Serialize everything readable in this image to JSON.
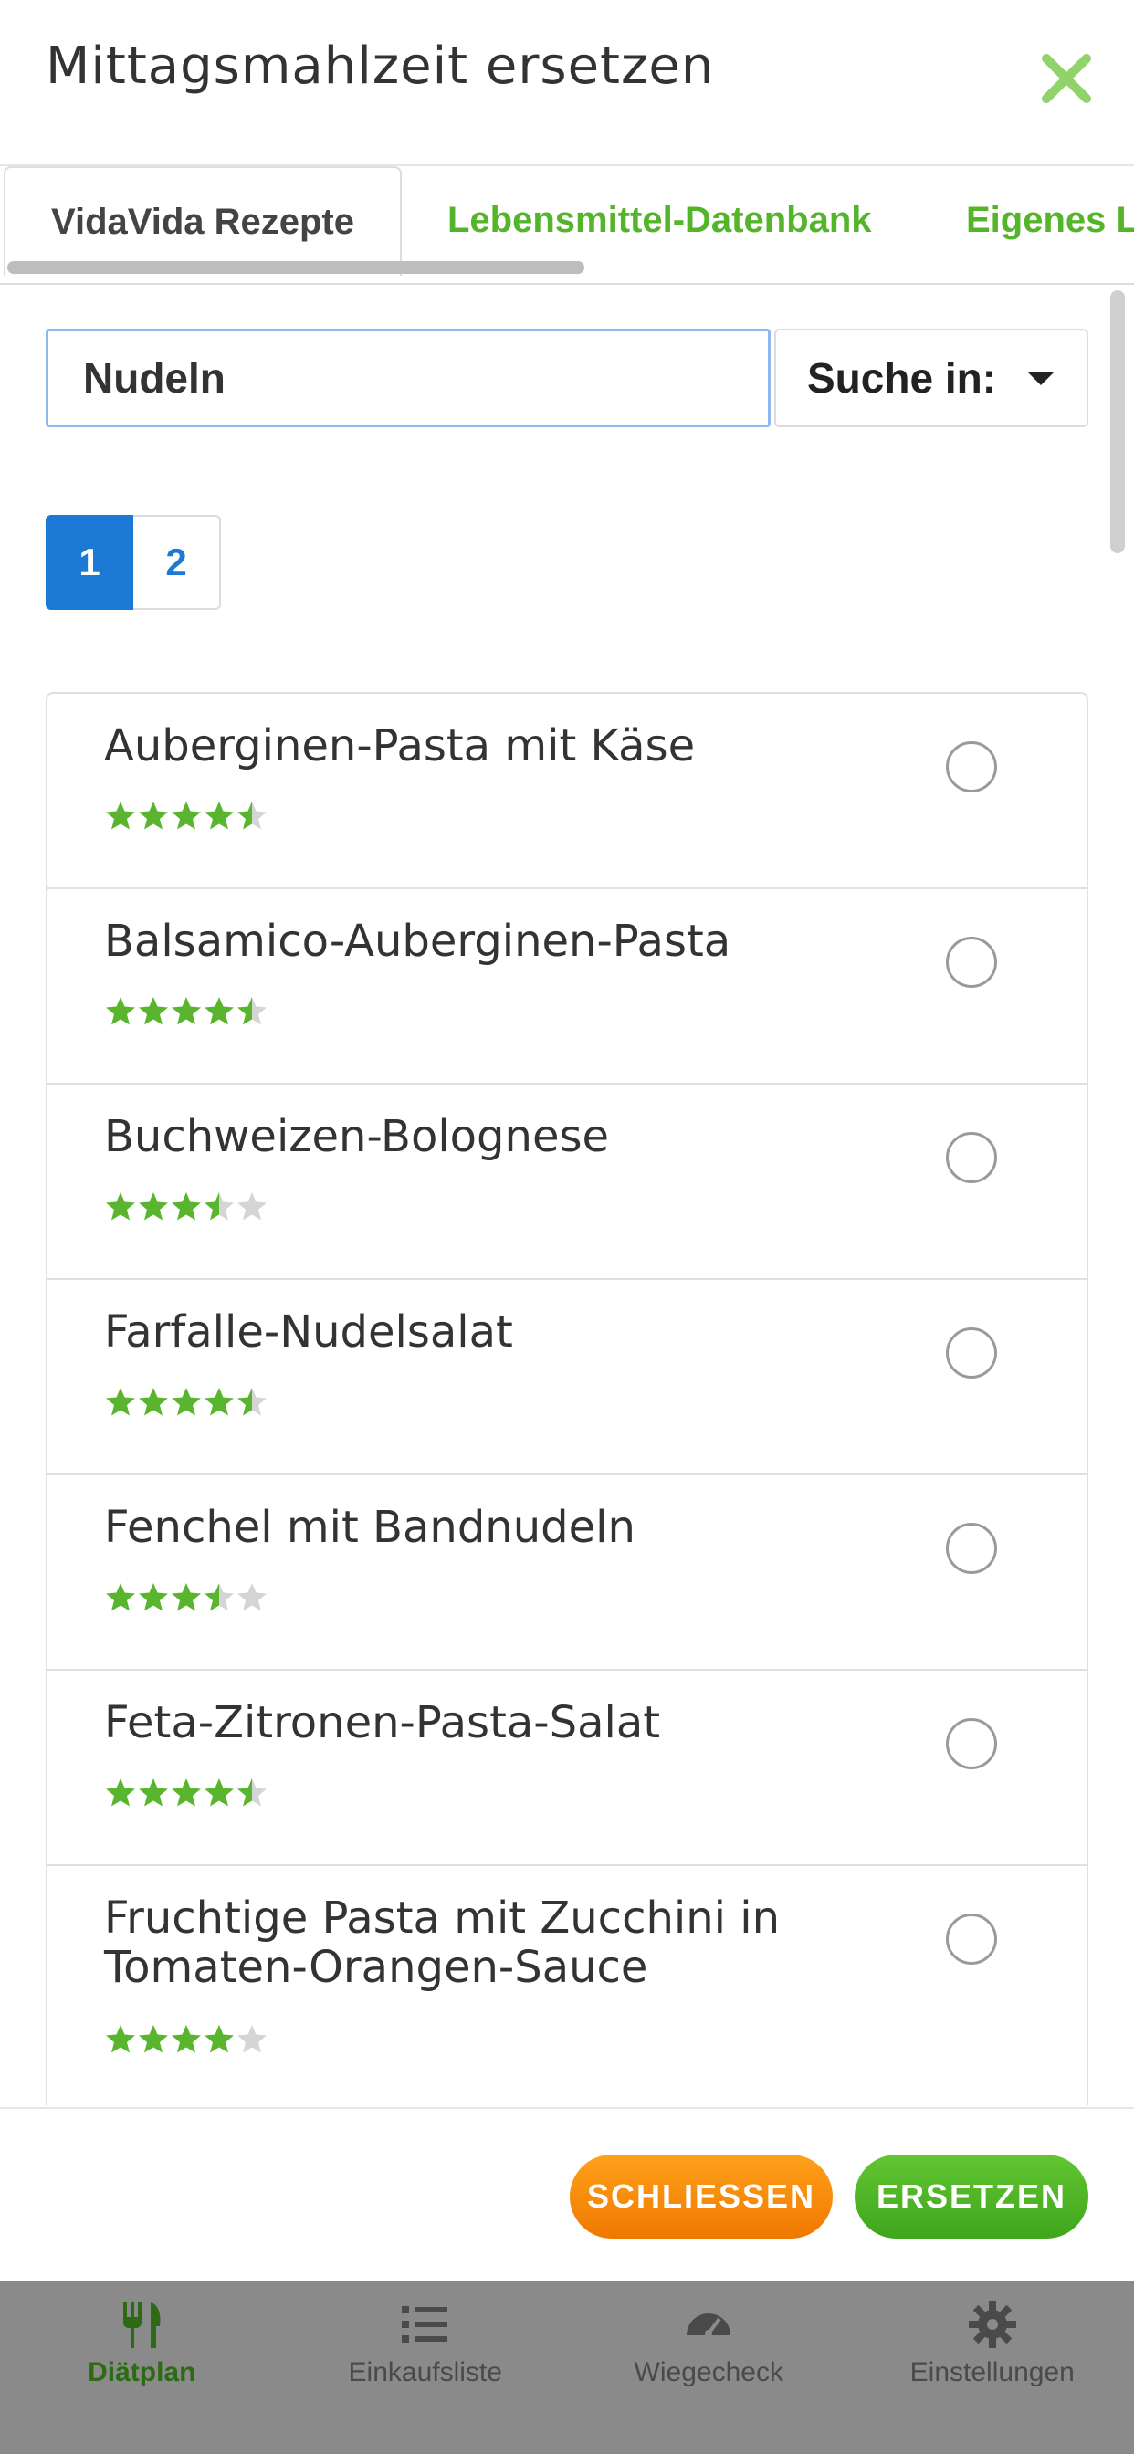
{
  "modal": {
    "title": "Mittagsmahlzeit ersetzen",
    "close_icon": "close-x-icon"
  },
  "tabs": [
    {
      "label": "VidaVida Rezepte",
      "active": true
    },
    {
      "label": "Lebensmittel-Datenbank",
      "active": false
    },
    {
      "label": "Eigenes Le",
      "active": false
    }
  ],
  "search": {
    "value": "Nudeln",
    "select_label": "Suche in:"
  },
  "pagination": {
    "pages": [
      "1",
      "2"
    ],
    "current": "1"
  },
  "recipes": [
    {
      "name": "Auberginen-Pasta mit Käse",
      "rating": 4.5,
      "selected": false
    },
    {
      "name": "Balsamico-Auberginen-Pasta",
      "rating": 4.5,
      "selected": false
    },
    {
      "name": "Buchweizen-Bolognese",
      "rating": 3.5,
      "selected": false
    },
    {
      "name": "Farfalle-Nudelsalat",
      "rating": 4.5,
      "selected": false
    },
    {
      "name": "Fenchel mit Bandnudeln",
      "rating": 3.5,
      "selected": false
    },
    {
      "name": "Feta-Zitronen-Pasta-Salat",
      "rating": 4.5,
      "selected": false
    },
    {
      "name": "Fruchtige Pasta mit Zucchini in Tomaten-Orangen-Sauce",
      "rating": 4,
      "selected": false
    }
  ],
  "footer": {
    "close_label": "SCHLIESSEN",
    "replace_label": "ERSETZEN"
  },
  "bottom_nav": [
    {
      "label": "Diätplan",
      "icon": "fork-knife-icon",
      "active": true
    },
    {
      "label": "Einkaufsliste",
      "icon": "list-icon",
      "active": false
    },
    {
      "label": "Wiegecheck",
      "icon": "gauge-icon",
      "active": false
    },
    {
      "label": "Einstellungen",
      "icon": "gear-icon",
      "active": false
    }
  ],
  "colors": {
    "accent_green": "#55b52a",
    "star_green": "#5ab52e",
    "star_empty": "#d5d5d5",
    "primary_blue": "#1c7ad6",
    "button_orange": "#f68b00",
    "button_green": "#4cb524"
  }
}
